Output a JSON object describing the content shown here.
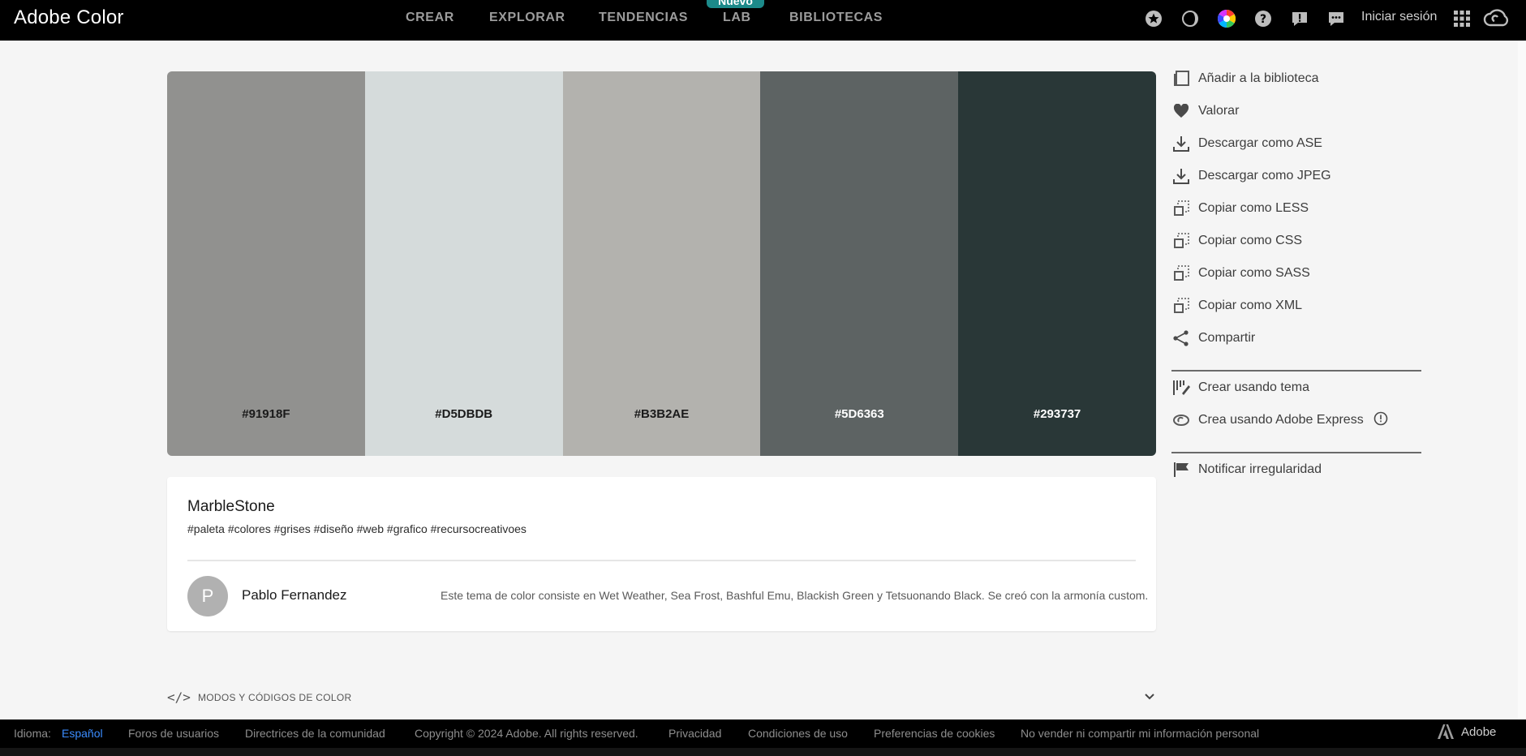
{
  "header": {
    "brand": "Adobe Color",
    "nav": [
      {
        "label": "CREAR"
      },
      {
        "label": "EXPLORAR"
      },
      {
        "label": "TENDENCIAS"
      },
      {
        "label": "LAB",
        "badge": "Nuevo"
      },
      {
        "label": "BIBLIOTECAS"
      }
    ],
    "icons": [
      "star-icon",
      "contrast-moon-icon",
      "color-wheel-icon",
      "help-icon",
      "feedback-alert-icon",
      "chat-icon"
    ],
    "signin": "Iniciar sesión"
  },
  "palette": {
    "swatches": [
      {
        "hex": "#91918F",
        "color": "#91918F",
        "text_color": "#1a1a1a"
      },
      {
        "hex": "#D5DBDB",
        "color": "#D5DBDB",
        "text_color": "#1a1a1a"
      },
      {
        "hex": "#B3B2AE",
        "color": "#B3B2AE",
        "text_color": "#1a1a1a"
      },
      {
        "hex": "#5D6363",
        "color": "#5D6363",
        "text_color": "#ffffff"
      },
      {
        "hex": "#293737",
        "color": "#293737",
        "text_color": "#ffffff"
      }
    ]
  },
  "actions": {
    "group1": [
      {
        "label": "Añadir a la biblioteca",
        "icon": "library-add-icon"
      },
      {
        "label": "Valorar",
        "icon": "heart-icon"
      },
      {
        "label": "Descargar como ASE",
        "icon": "download-icon"
      },
      {
        "label": "Descargar como JPEG",
        "icon": "download-icon"
      },
      {
        "label": "Copiar como LESS",
        "icon": "copy-icon"
      },
      {
        "label": "Copiar como CSS",
        "icon": "copy-icon"
      },
      {
        "label": "Copiar como SASS",
        "icon": "copy-icon"
      },
      {
        "label": "Copiar como XML",
        "icon": "copy-icon"
      },
      {
        "label": "Compartir",
        "icon": "share-icon"
      }
    ],
    "group2": [
      {
        "label": "Crear usando tema",
        "icon": "brush-icon"
      },
      {
        "label": "Crea usando Adobe Express",
        "icon": "express-icon"
      }
    ],
    "group3": [
      {
        "label": "Notificar irregularidad",
        "icon": "flag-icon"
      }
    ]
  },
  "theme": {
    "title": "MarbleStone",
    "tags": "#paleta #colores #grises #diseño #web #grafico #recursocreativoes",
    "author_initial": "P",
    "author": "Pablo Fernandez",
    "description": "Este tema de color consiste en Wet Weather, Sea Frost, Bashful Emu, Blackish Green y Tetsuonando Black. Se creó con la armonía custom."
  },
  "modes": {
    "code_glyph": "</>",
    "label": "MODOS Y CÓDIGOS DE COLOR"
  },
  "footer": {
    "lang_label": "Idioma:",
    "lang_value": "Español",
    "links": [
      "Foros de usuarios",
      "Directrices de la comunidad",
      "Copyright © 2024 Adobe. All rights reserved.",
      "Privacidad",
      "Condiciones de uso",
      "Preferencias de cookies",
      "No vender ni compartir mi información personal"
    ],
    "adobe": "Adobe"
  },
  "colors": {
    "accent_teal": "#1c8a8a",
    "link_blue": "#3b8cff"
  }
}
